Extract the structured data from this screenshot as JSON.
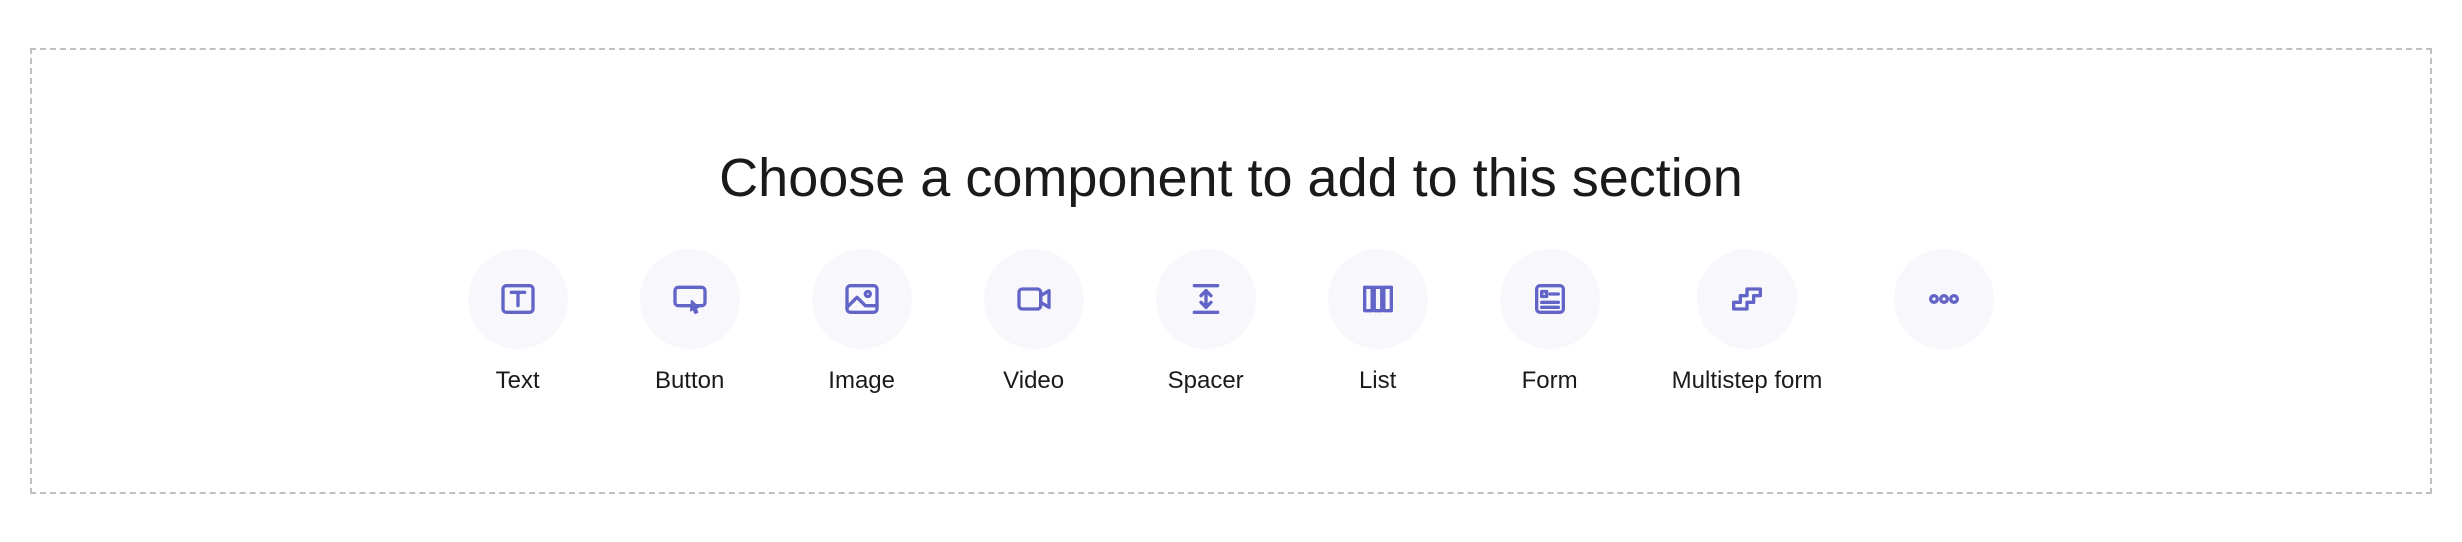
{
  "section": {
    "heading": "Choose a component to add to this section",
    "components": {
      "text": "Text",
      "button": "Button",
      "image": "Image",
      "video": "Video",
      "spacer": "Spacer",
      "list": "List",
      "form": "Form",
      "multistep_form": "Multistep form"
    },
    "icons": {
      "text": "text-icon",
      "button": "button-icon",
      "image": "image-icon",
      "video": "video-icon",
      "spacer": "spacer-icon",
      "list": "list-icon",
      "form": "form-icon",
      "multistep_form": "multistep-form-icon",
      "more": "more-icon"
    },
    "colors": {
      "icon_accent": "#6264c7",
      "icon_bg": "#f7f7fc",
      "border": "#c0c0c0",
      "text": "#1a1a1a"
    }
  }
}
